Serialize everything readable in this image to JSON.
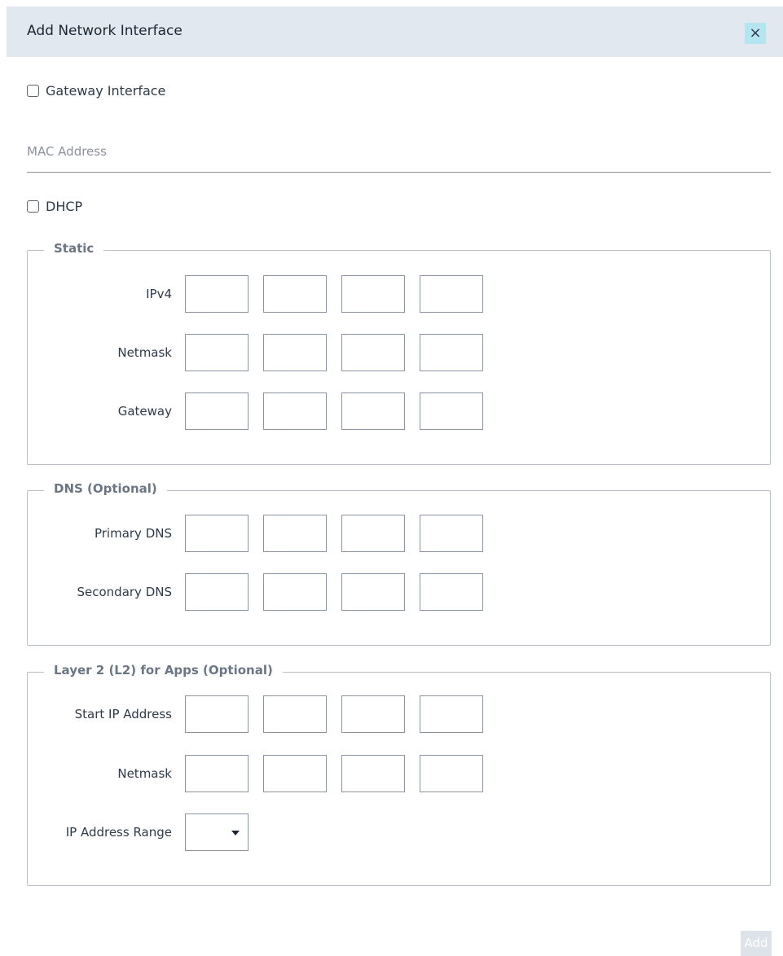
{
  "dialog": {
    "title": "Add Network Interface",
    "close_label": "×"
  },
  "gateway_interface": {
    "label": "Gateway Interface",
    "checked": false
  },
  "mac_address": {
    "placeholder": "MAC Address",
    "value": ""
  },
  "dhcp": {
    "label": "DHCP",
    "checked": false
  },
  "static_group": {
    "legend": "Static",
    "rows": [
      {
        "label": "IPv4",
        "values": [
          "",
          "",
          "",
          ""
        ]
      },
      {
        "label": "Netmask",
        "values": [
          "",
          "",
          "",
          ""
        ]
      },
      {
        "label": "Gateway",
        "values": [
          "",
          "",
          "",
          ""
        ]
      }
    ]
  },
  "dns_group": {
    "legend": "DNS (Optional)",
    "rows": [
      {
        "label": "Primary DNS",
        "values": [
          "",
          "",
          "",
          ""
        ]
      },
      {
        "label": "Secondary DNS",
        "values": [
          "",
          "",
          "",
          ""
        ]
      }
    ]
  },
  "l2_group": {
    "legend": "Layer 2 (L2) for Apps (Optional)",
    "rows": [
      {
        "label": "Start IP Address",
        "values": [
          "",
          "",
          "",
          ""
        ]
      },
      {
        "label": "Netmask",
        "values": [
          "",
          "",
          "",
          ""
        ]
      }
    ],
    "range": {
      "label": "IP Address Range",
      "selected": ""
    }
  },
  "footer": {
    "add_label": "Add"
  },
  "colors": {
    "header_bg": "#e1e8ef",
    "close_bg": "#b5e6ef",
    "border": "#b7c1cc",
    "add_disabled_bg": "#dde3e9"
  }
}
